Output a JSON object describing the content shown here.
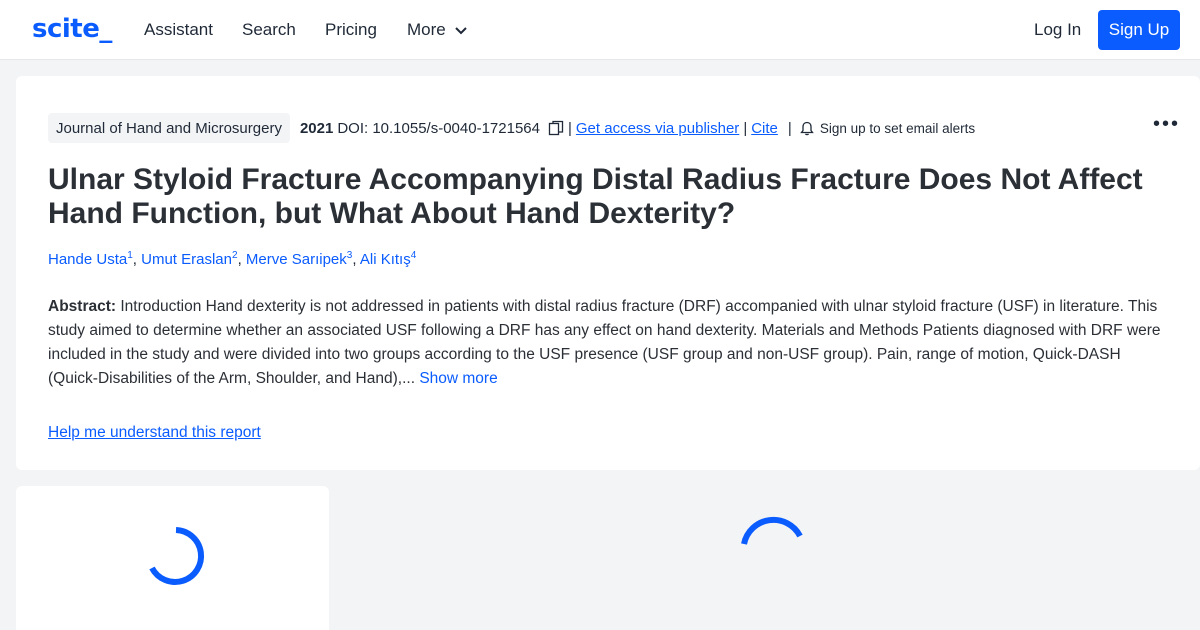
{
  "nav": {
    "logo": "scite_",
    "links": [
      "Assistant",
      "Search",
      "Pricing",
      "More"
    ],
    "login": "Log In",
    "signup": "Sign Up"
  },
  "paper": {
    "journal": "Journal of Hand and Microsurgery",
    "year": "2021",
    "doi": "DOI: 10.1055/s-0040-1721564",
    "access_link": "Get access via publisher",
    "cite_link": "Cite",
    "alerts": "Sign up to set email alerts",
    "title": "Ulnar Styloid Fracture Accompanying Distal Radius Fracture Does Not Affect Hand Function, but What About Hand Dexterity?",
    "authors": [
      {
        "name": "Hande Usta",
        "sup": "1"
      },
      {
        "name": "Umut Eraslan",
        "sup": "2"
      },
      {
        "name": "Merve Sarıipek",
        "sup": "3"
      },
      {
        "name": "Ali Kıtış",
        "sup": "4"
      }
    ],
    "abstract_label": "Abstract:",
    "abstract_text": " Introduction    Hand dexterity is not addressed in patients with distal radius fracture (DRF) accompanied with ulnar styloid fracture (USF) in literature. This study aimed to determine whether an associated USF following a DRF has any effect on hand dexterity. Materials and Methods    Patients diagnosed with DRF were included in the study and were divided into two groups according to the USF presence (USF group and non-USF group). Pain, range of motion, Quick-DASH (Quick-Disabilities of the Arm, Shoulder, and Hand),...",
    "show_more": "Show more",
    "help_link": "Help me understand this report"
  },
  "icons": {
    "copy": "copy-icon",
    "bell": "bell-icon",
    "more": "more-options-icon",
    "chevron": "chevron-down-icon"
  },
  "colors": {
    "accent": "#0b5cff",
    "background": "#f3f4f6"
  }
}
